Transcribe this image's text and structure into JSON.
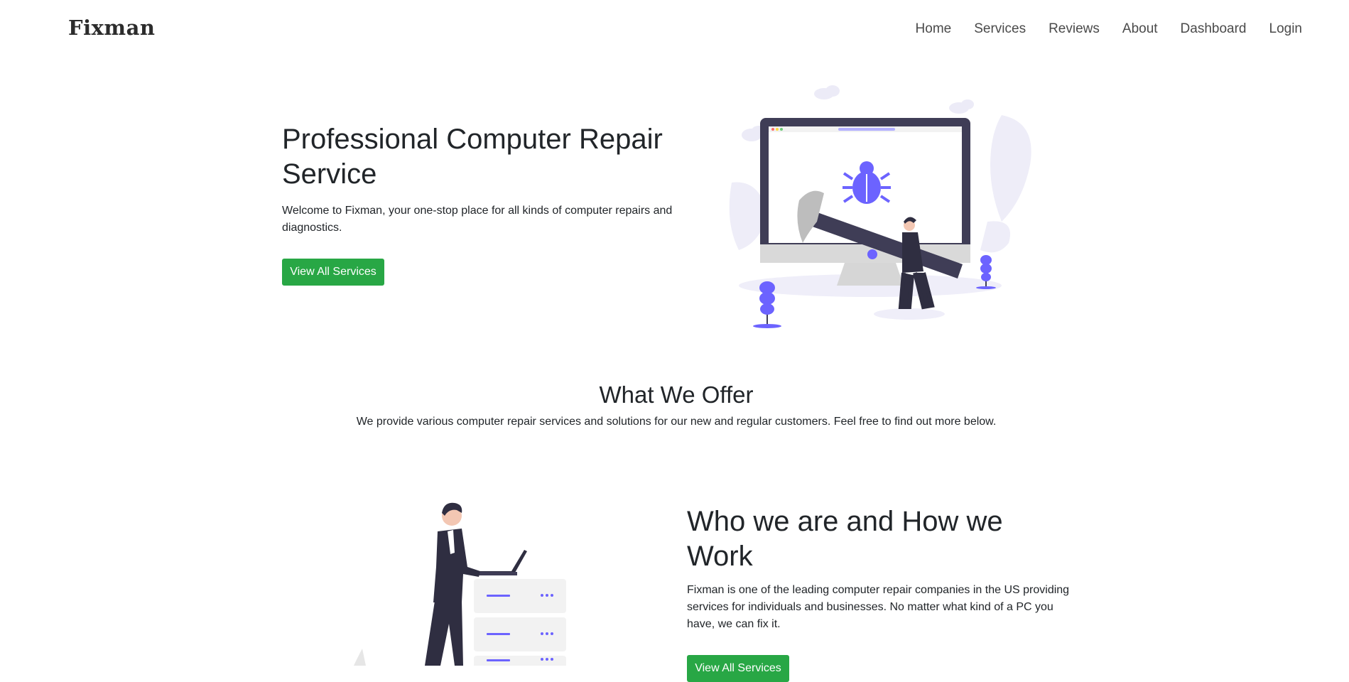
{
  "navbar": {
    "brand": "Fixman",
    "links": [
      "Home",
      "Services",
      "Reviews",
      "About",
      "Dashboard",
      "Login"
    ]
  },
  "hero": {
    "title": "Professional Computer Repair Service",
    "text": "Welcome to Fixman, your one-stop place for all kinds of computer repairs and diagnostics.",
    "button": "View All Services",
    "illustration": "computer-repair-illustration"
  },
  "offer": {
    "title": "What We Offer",
    "text": "We provide various computer repair services and solutions for our new and regular customers. Feel free to find out more below."
  },
  "about": {
    "title": "Who we are and How we Work",
    "text": "Fixman is one of the leading computer repair companies in the US providing services for individuals and businesses. No matter what kind of a PC you have, we can fix it.",
    "button": "View All Services",
    "illustration": "server-technician-illustration"
  },
  "colors": {
    "accent": "#6c63ff",
    "button": "#28a745",
    "dark": "#2f2e41"
  }
}
